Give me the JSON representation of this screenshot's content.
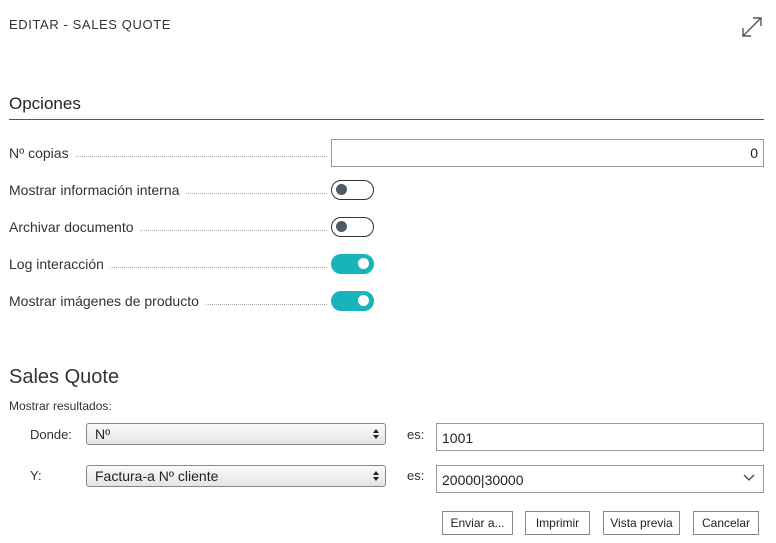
{
  "header": {
    "title": "EDITAR - SALES QUOTE",
    "expand_icon": "expand-icon"
  },
  "options": {
    "title": "Opciones",
    "copies": {
      "label": "Nº copias",
      "value": "0"
    },
    "toggles": [
      {
        "label": "Mostrar información interna",
        "on": false
      },
      {
        "label": "Archivar documento",
        "on": false
      },
      {
        "label": "Log interacción",
        "on": true
      },
      {
        "label": "Mostrar imágenes de producto",
        "on": true
      }
    ]
  },
  "sales_quote": {
    "title": "Sales Quote",
    "show_results": "Mostrar resultados:",
    "filters": [
      {
        "prefix": "Donde:",
        "field": "Nº",
        "op": "es:",
        "value": "1001"
      },
      {
        "prefix": "Y:",
        "field": "Factura-a Nº cliente",
        "op": "es:",
        "value": "20000|30000"
      }
    ]
  },
  "buttons": {
    "send": "Enviar a...",
    "print": "Imprimir",
    "preview": "Vista previa",
    "cancel": "Cancelar"
  },
  "colors": {
    "toggle_on": "#18b3bb",
    "toggle_off_knob": "#505a66"
  }
}
